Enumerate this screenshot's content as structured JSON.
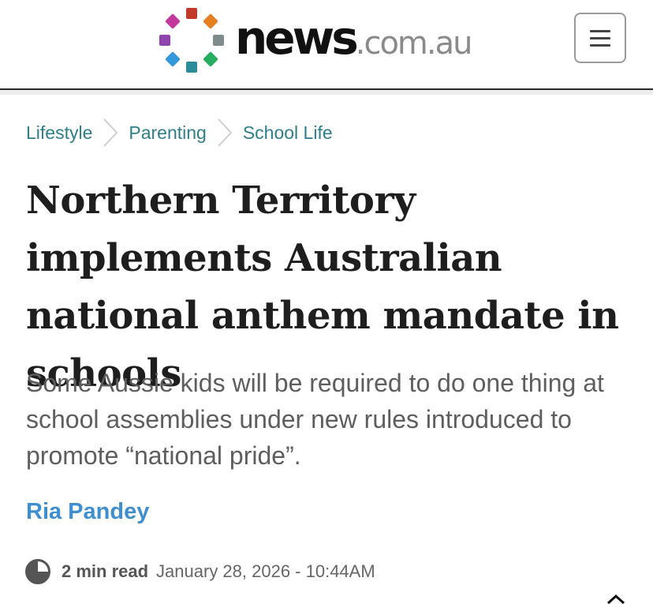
{
  "header": {
    "logo": {
      "word": "news",
      "domain": ".com.au",
      "dot_colors": [
        "#c0392b",
        "#e67e22",
        "#7f8c8d",
        "#27ae60",
        "#2c8c99",
        "#3498db",
        "#8e44ad",
        "#c2399b"
      ]
    },
    "menu_icon": "hamburger-icon"
  },
  "breadcrumb": {
    "items": [
      {
        "label": "Lifestyle"
      },
      {
        "label": "Parenting"
      },
      {
        "label": "School Life"
      }
    ],
    "separator_icon": "chevron-right-icon"
  },
  "article": {
    "headline": "Northern Territory implements Australian national anthem mandate in schools",
    "standfirst": "Some Aussie kids will be required to do one thing at school assemblies under new rules introduced to promote “national pride”.",
    "author": "Ria Pandey",
    "read_time": "2 min read",
    "timestamp": "January 28, 2026 - 10:44AM",
    "clock_icon": "clock-icon"
  },
  "colors": {
    "link_teal": "#2d7f89",
    "author_blue": "#3f8fd0",
    "standfirst_grey": "#5e5e5e"
  }
}
